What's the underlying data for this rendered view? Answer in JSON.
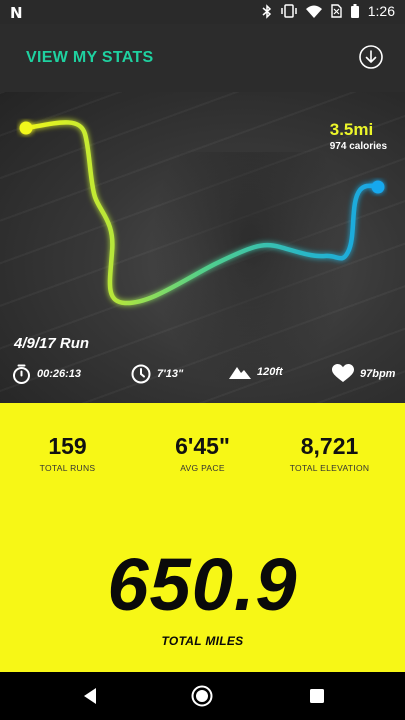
{
  "colors": {
    "accent": "#1fd1a0",
    "yellow": "#f7f716",
    "hero_yellow": "#ecf62a",
    "route_blue": "#1aa7e8"
  },
  "status_bar": {
    "time": "1:26",
    "icons": [
      "n-logo-icon",
      "bluetooth-icon",
      "vibrate-icon",
      "wifi-icon",
      "no-sim-icon",
      "battery-icon"
    ]
  },
  "header": {
    "title": "VIEW MY STATS",
    "action_icon": "download-circle-icon"
  },
  "run": {
    "distance": "3.5mi",
    "calories": "974 calories",
    "date_label": "4/9/17 Run",
    "duration": "00:26:13",
    "pace": "7'13\"",
    "elevation": "120ft",
    "heart_rate": "97bpm"
  },
  "stats": [
    {
      "value": "159",
      "label": "TOTAL RUNS"
    },
    {
      "value": "6'45\"",
      "label": "AVG PACE"
    },
    {
      "value": "8,721",
      "label": "TOTAL ELEVATION"
    }
  ],
  "total": {
    "value": "650.9",
    "label": "TOTAL MILES"
  },
  "nav": {
    "icons": [
      "back-icon",
      "home-icon",
      "recents-icon"
    ]
  }
}
